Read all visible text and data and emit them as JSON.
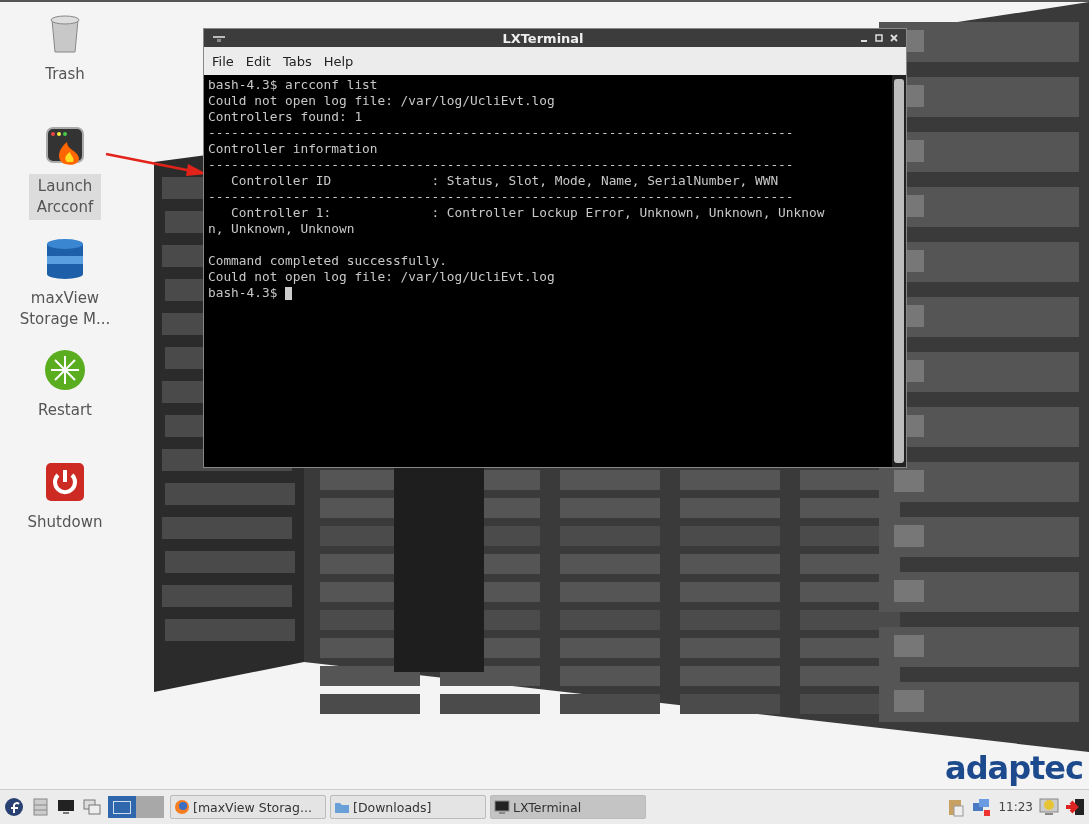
{
  "desktop_icons": [
    {
      "kind": "trash",
      "label": "Trash",
      "selected": false
    },
    {
      "kind": "arcconf",
      "label": "Launch Arcconf",
      "selected": true
    },
    {
      "kind": "maxview",
      "label": "maxView Storage M...",
      "selected": false
    },
    {
      "kind": "restart",
      "label": "Restart",
      "selected": false
    },
    {
      "kind": "shutdown",
      "label": "Shutdown",
      "selected": false
    }
  ],
  "terminal": {
    "title": "LXTerminal",
    "menu": [
      "File",
      "Edit",
      "Tabs",
      "Help"
    ],
    "lines": [
      {
        "kind": "text",
        "text": "bash-4.3$ arcconf list"
      },
      {
        "kind": "text",
        "text": "Could not open log file: /var/log/UcliEvt.log"
      },
      {
        "kind": "text",
        "text": "Controllers found: 1"
      },
      {
        "kind": "rule",
        "text": "----------------------------------------------------------------------------"
      },
      {
        "kind": "text",
        "text": "Controller information"
      },
      {
        "kind": "rule",
        "text": "----------------------------------------------------------------------------"
      },
      {
        "kind": "text",
        "text": "   Controller ID             : Status, Slot, Mode, Name, SerialNumber, WWN"
      },
      {
        "kind": "rule",
        "text": "----------------------------------------------------------------------------"
      },
      {
        "kind": "text",
        "text": "   Controller 1:             : Controller Lockup Error, Unknown, Unknown, Unknow"
      },
      {
        "kind": "text",
        "text": "n, Unknown, Unknown"
      },
      {
        "kind": "blank"
      },
      {
        "kind": "text",
        "text": "Command completed successfully."
      },
      {
        "kind": "text",
        "text": "Could not open log file: /var/log/UcliEvt.log"
      },
      {
        "kind": "prompt",
        "text": "bash-4.3$"
      }
    ]
  },
  "logo": "adaptec",
  "taskbar": {
    "launchers": [
      {
        "kind": "fedora"
      },
      {
        "kind": "files"
      },
      {
        "kind": "monitor"
      },
      {
        "kind": "windows"
      }
    ],
    "desktops": [
      {
        "selected": true
      },
      {
        "selected": false
      }
    ],
    "tasks": [
      {
        "kind": "browser",
        "label": "[maxView Storag...",
        "selected": false
      },
      {
        "kind": "folder",
        "label": "[Downloads]",
        "selected": false
      },
      {
        "kind": "terminal",
        "label": "LXTerminal",
        "selected": true
      }
    ],
    "tray": [
      {
        "kind": "clipboard"
      },
      {
        "kind": "network"
      },
      {
        "kind": "clock",
        "text": "11:23"
      },
      {
        "kind": "lock"
      },
      {
        "kind": "exit"
      }
    ]
  }
}
